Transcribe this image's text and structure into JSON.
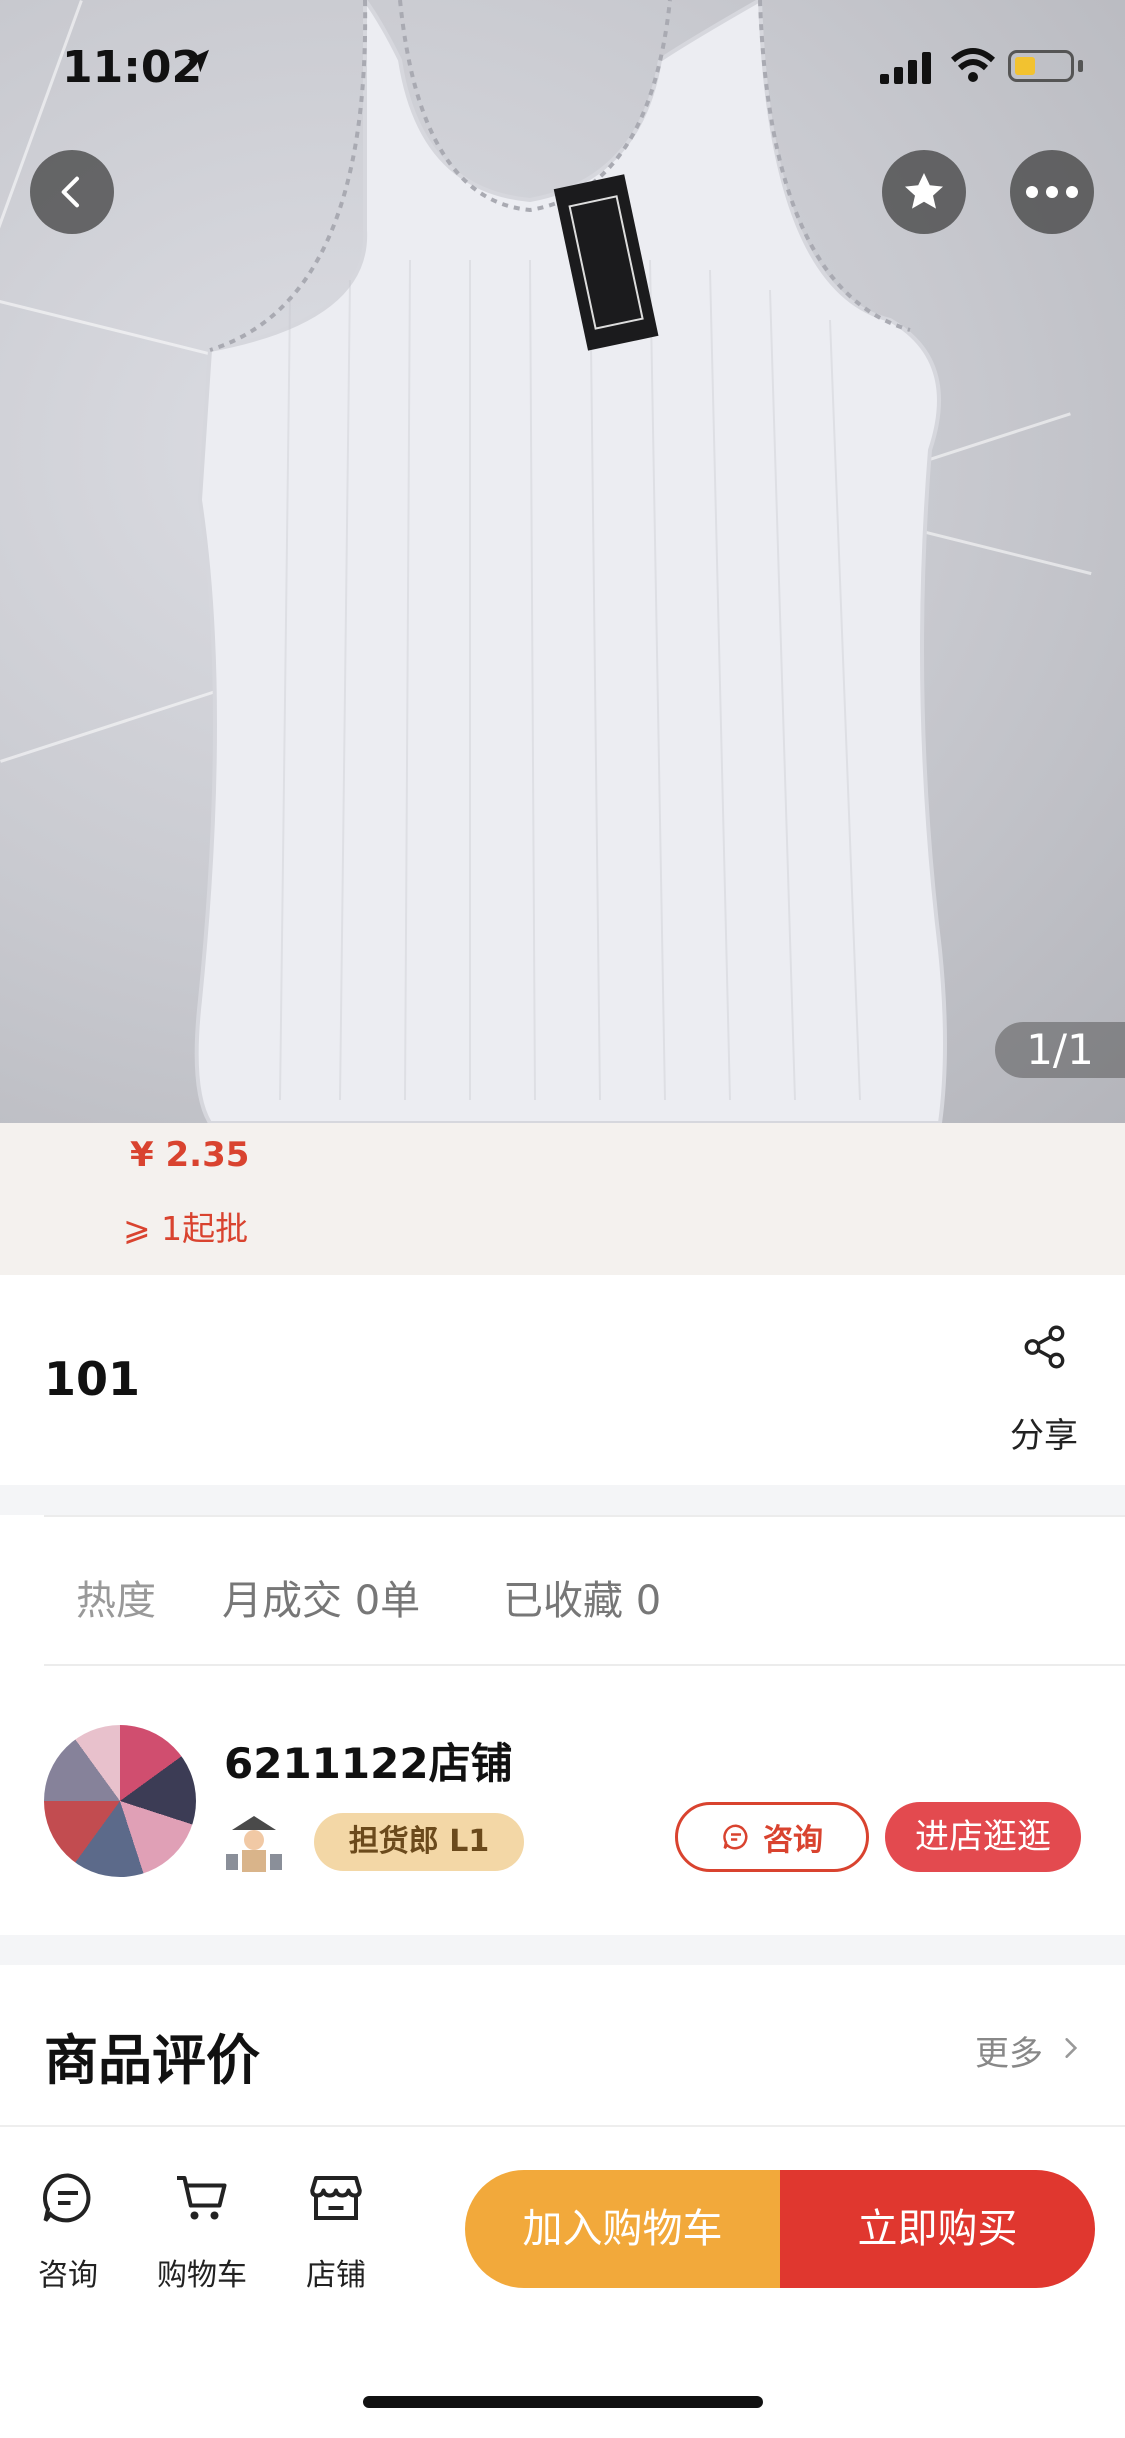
{
  "status_bar": {
    "time": "11:02"
  },
  "gallery": {
    "counter": "1/1"
  },
  "price": {
    "amount": "¥ 2.35",
    "min_order": "⩾ 1起批"
  },
  "product": {
    "title": "101",
    "share_label": "分享"
  },
  "stats": {
    "heat_label": "热度",
    "monthly_deals": "月成交 0单",
    "favorites": "已收藏 0"
  },
  "shop": {
    "name": "6211122店铺",
    "level_badge": "担货郎 L1",
    "consult_label": "咨询",
    "enter_label": "进店逛逛"
  },
  "reviews": {
    "title": "商品评价",
    "more_label": "更多"
  },
  "bottom_bar": {
    "tabs": [
      {
        "label": "咨询",
        "icon": "chat-icon"
      },
      {
        "label": "购物车",
        "icon": "cart-icon"
      },
      {
        "label": "店铺",
        "icon": "store-icon"
      }
    ],
    "add_to_cart": "加入购物车",
    "buy_now": "立即购买"
  },
  "colors": {
    "accent_red": "#e0372f",
    "accent_orange": "#f2a93b",
    "price_red": "#d9432f",
    "badge_gold": "#f3d7a6"
  }
}
